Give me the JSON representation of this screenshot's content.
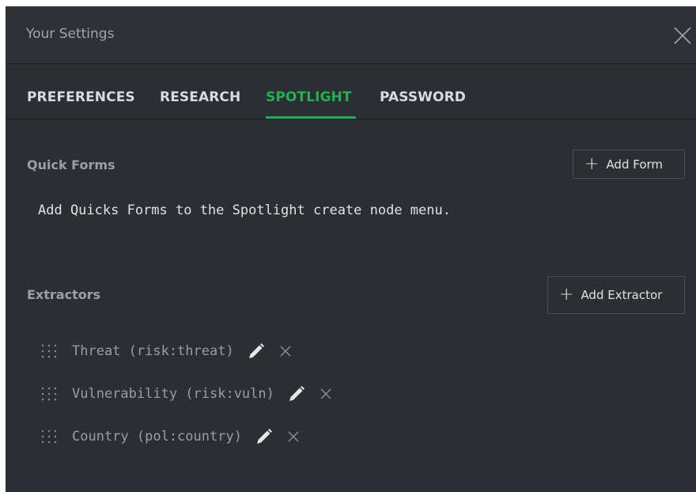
{
  "dialog": {
    "title": "Your Settings",
    "close_icon": "close-icon"
  },
  "tabs": [
    {
      "label": "PREFERENCES",
      "active": false
    },
    {
      "label": "RESEARCH",
      "active": false
    },
    {
      "label": "SPOTLIGHT",
      "active": true
    },
    {
      "label": "PASSWORD",
      "active": false
    }
  ],
  "quick_forms": {
    "title": "Quick Forms",
    "add_button_label": "Add Form",
    "add_icon": "plus-icon",
    "helper_text": "Add Quicks Forms to the Spotlight create node menu."
  },
  "extractors": {
    "title": "Extractors",
    "add_button_label": "Add Extractor",
    "add_icon": "plus-icon",
    "items": [
      {
        "label": "Threat (risk:threat)"
      },
      {
        "label": "Vulnerability (risk:vuln)"
      },
      {
        "label": "Country (pol:country)"
      }
    ]
  },
  "colors": {
    "background": "#2b2e33",
    "accent": "#22b14c",
    "text_primary": "#dfe1e3",
    "text_muted": "#9a9da2"
  }
}
